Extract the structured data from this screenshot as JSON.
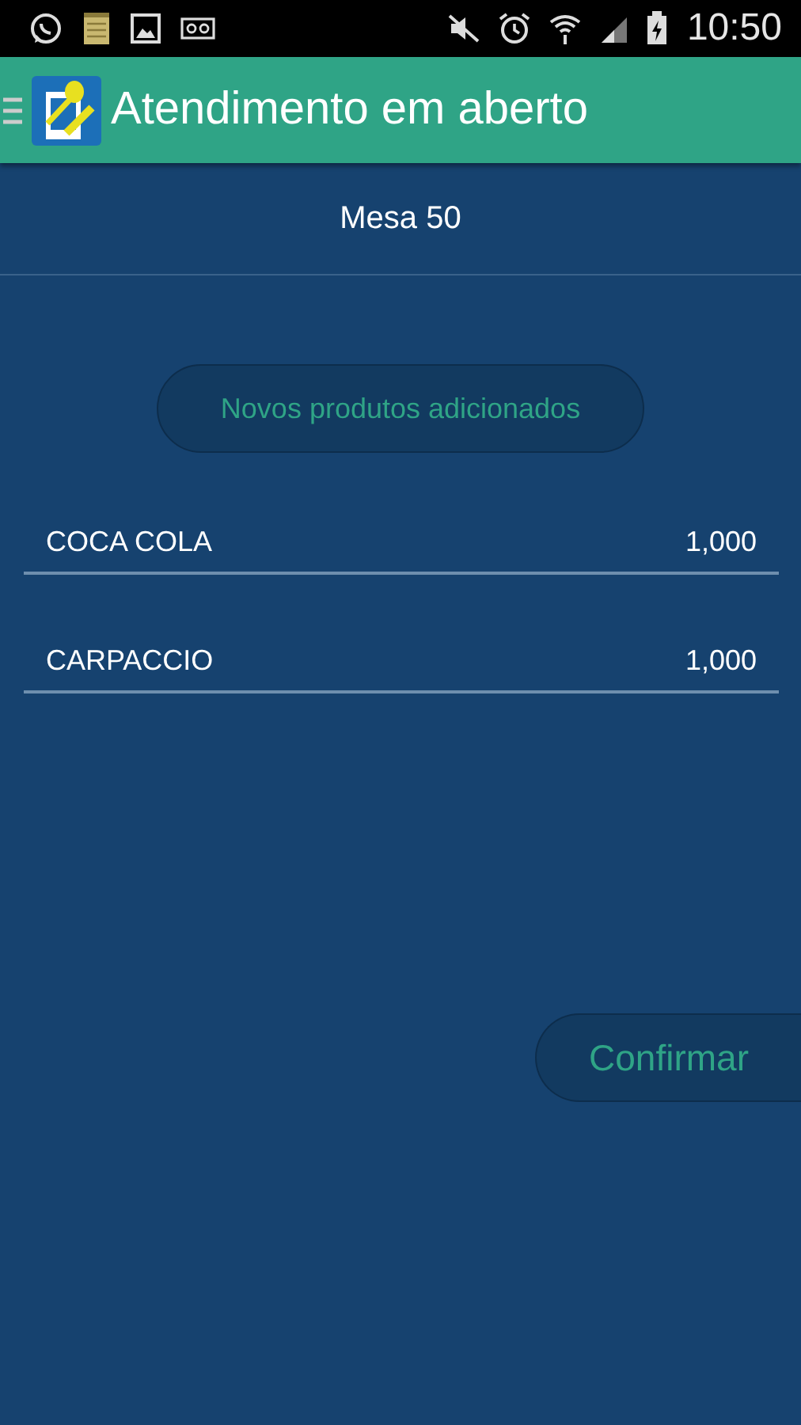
{
  "status_bar": {
    "time": "10:50"
  },
  "app_bar": {
    "title": "Atendimento em aberto"
  },
  "table_header": "Mesa 50",
  "notice_button": "Novos produtos adicionados",
  "items": [
    {
      "name": "COCA COLA",
      "quantity": "1,000"
    },
    {
      "name": "CARPACCIO",
      "quantity": "1,000"
    }
  ],
  "confirm_button": "Confirmar"
}
